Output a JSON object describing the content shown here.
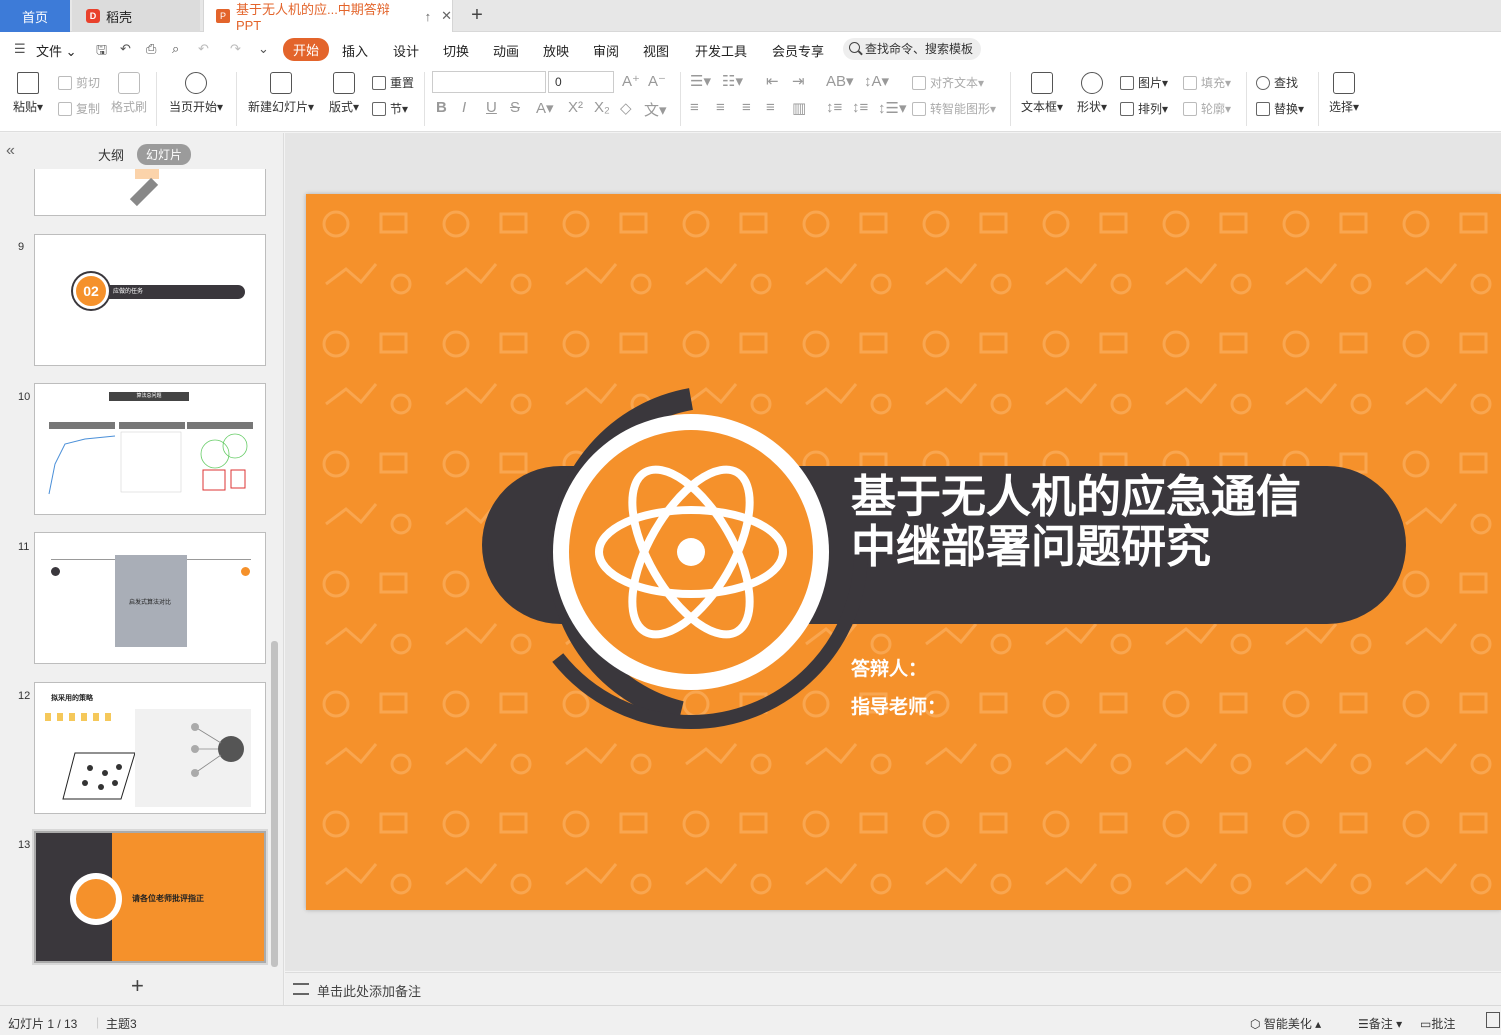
{
  "tabs": {
    "home": "首页",
    "docer": "稻壳",
    "document": "基于无人机的应...中期答辩PPT"
  },
  "menu": {
    "file": "文件",
    "items": [
      "开始",
      "插入",
      "设计",
      "切换",
      "动画",
      "放映",
      "审阅",
      "视图",
      "开发工具",
      "会员专享"
    ],
    "active": "开始",
    "search_placeholder": "查找命令、搜索模板"
  },
  "ribbon": {
    "paste": "粘贴",
    "cut": "剪切",
    "copy": "复制",
    "format_painter": "格式刷",
    "from_start": "当页开始",
    "new_slide": "新建幻灯片",
    "layout": "版式",
    "reset": "重置",
    "section": "节",
    "font_size": "0",
    "align_text": "对齐文本",
    "smartart": "转智能图形",
    "textbox": "文本框",
    "shapes": "形状",
    "picture": "图片",
    "arrange": "排列",
    "fill": "填充",
    "outline": "轮廓",
    "find": "查找",
    "replace": "替换",
    "select": "选择"
  },
  "left_panel": {
    "tab_outline": "大纲",
    "tab_slides": "幻灯片",
    "thumbnails": [
      {
        "num": "9",
        "text": "应做的任务",
        "badge": "02"
      },
      {
        "num": "10",
        "text": "算法总问题"
      },
      {
        "num": "11",
        "text": "启发式算法对比"
      },
      {
        "num": "12",
        "text": "拟采用的策略"
      },
      {
        "num": "13",
        "text": "请各位老师批评指正"
      }
    ]
  },
  "slide": {
    "title_line1": "基于无人机的应急通信",
    "title_line2": "中继部署问题研究",
    "defender_label": "答辩人：",
    "advisor_label": "指导老师："
  },
  "colors": {
    "accent": "#e3642b",
    "slide_bg": "#f5912b",
    "dark_band": "#3a373c"
  },
  "notes": {
    "placeholder": "单击此处添加备注"
  },
  "status": {
    "slide_counter": "幻灯片 1 / 13",
    "theme": "主题3",
    "smart_beautify": "智能美化",
    "notes_btn": "备注",
    "comments_btn": "批注"
  }
}
